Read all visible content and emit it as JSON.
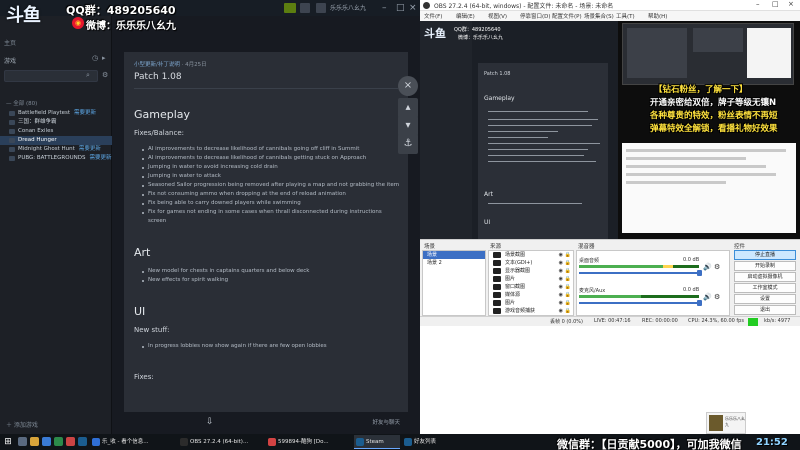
{
  "overlay": {
    "logo": "斗鱼",
    "qq_group": "QQ群：489205640",
    "weibo": "微博：乐乐乐八幺九",
    "taskbar_promo": "微信群：【日贡献5000】，可加我微信",
    "clock": "21:52"
  },
  "steam": {
    "user": "乐乐乐八幺九",
    "home_label": "主页",
    "filter_label": "游戏",
    "add_game_label": "添加游戏",
    "friends_label": "好友与聊天",
    "sidebar_games": [
      {
        "label": "— 全部 (80)",
        "header": true,
        "selected": false,
        "tag": ""
      },
      {
        "label": "Battlefield Playtest",
        "header": false,
        "selected": false,
        "tag": "需要更新"
      },
      {
        "label": "三国：群雄争霸",
        "header": false,
        "selected": false,
        "tag": ""
      },
      {
        "label": "Conan Exiles",
        "header": false,
        "selected": false,
        "tag": ""
      },
      {
        "label": "Dread Hunger",
        "header": false,
        "selected": true,
        "tag": ""
      },
      {
        "label": "Midnight Ghost Hunt",
        "header": false,
        "selected": false,
        "tag": "需要更新"
      },
      {
        "label": "PUBG: BATTLEGROUNDS",
        "header": false,
        "selected": false,
        "tag": "需要更新"
      }
    ],
    "news": {
      "meta_link": "小型更新/补丁说明",
      "meta_date": "4月25日",
      "title": "Patch 1.08",
      "sections": [
        {
          "heading": "Gameplay",
          "subheading": "Fixes/Balance:",
          "items": [
            "AI improvements to decrease likelihood of cannibals going off cliff in Summit",
            "AI improvements to decrease likelihood of cannibals getting stuck on Approach",
            "Jumping in water to avoid increasing cold drain",
            "Jumping in water to attack",
            "Seasoned Sailor progression being removed after playing a map and not grabbing the item",
            "Fix not consuming ammo when dropping at the end of reload animation",
            "Fix being able to carry downed players while swimming",
            "Fix for games not ending in some cases when thrall disconnected during instructions screen"
          ]
        },
        {
          "heading": "Art",
          "subheading": "",
          "items": [
            "New model for chests in captains quarters and below deck",
            "New effects for spirit walking"
          ]
        },
        {
          "heading": "UI",
          "subheading": "New stuff:",
          "items": [
            "In progress lobbies now show again if there are few open lobbies"
          ]
        },
        {
          "heading": "",
          "subheading": "Fixes:",
          "items": []
        }
      ]
    },
    "rail_icons": [
      "close-icon",
      "chevron-up-icon",
      "chevron-down-icon",
      "anchor-icon"
    ]
  },
  "obs": {
    "title": "OBS 27.2.4 (64-bit, windows) - 配置文件: 未命名 - 场景: 未命名",
    "menu": [
      "文件(F)",
      "编辑(E)",
      "视图(V)",
      "停靠窗口(D)",
      "配置文件(P)",
      "场景集合(S)",
      "工具(T)",
      "帮助(H)"
    ],
    "preview": {
      "news_title": "Patch 1.08",
      "gameplay": "Gameplay",
      "art": "Art",
      "ui": "UI",
      "qq": "QQ群：489205640",
      "weibo": "微博：乐乐乐八幺九",
      "danmu": [
        {
          "text": "【钻石粉丝，了解一下】",
          "color": "yellow"
        },
        {
          "text": "开通亲密给双倍，牌子等级无镶N",
          "color": "white"
        },
        {
          "text": "各种尊贵的特效，粉丝表情不再短",
          "color": "yellow"
        },
        {
          "text": "弹幕特效全解锁，看播礼物好效果",
          "color": "yellow"
        }
      ]
    },
    "docks": {
      "scenes_title": "场景",
      "sources_title": "来源",
      "mixer_title": "混音器",
      "controls_title": "控件"
    },
    "scenes": [
      "场景",
      "场景 2"
    ],
    "sources": [
      "场景截图",
      "文本(GDI+)",
      "显示器截图",
      "图片",
      "窗口截图",
      "媒体源",
      "图片",
      "游戏音频捕获"
    ],
    "mixer": [
      {
        "name": "桌面音频",
        "db": "0.0 dB",
        "level": 0.78
      },
      {
        "name": "麦克风/Aux",
        "db": "0.0 dB",
        "level": 0.52
      }
    ],
    "controls": [
      "停止直播",
      "开始录制",
      "启动虚拟摄像机",
      "工作室模式",
      "设置",
      "退出"
    ],
    "status": {
      "dropped": "丢帧 0 (0.0%)",
      "live": "LIVE: 00:47:16",
      "rec": "REC: 00:00:00",
      "cpu": "CPU: 24.3%, 60.00 fps",
      "kbps": "kb/s: 4977"
    }
  },
  "taskbar": {
    "tasks": [
      {
        "label": "乐_收 - 看个信息...",
        "color": "#2f6fd6",
        "active": false
      },
      {
        "label": "OBS 27.2.4 (64-bit)...",
        "color": "#2b2b2b",
        "active": false
      },
      {
        "label": "599894-酷狗 [Do...",
        "color": "#d34343",
        "active": false
      },
      {
        "label": "Steam",
        "color": "#1b5d8f",
        "active": true
      },
      {
        "label": "好友列表",
        "color": "#1b5d8f",
        "active": false
      }
    ]
  },
  "colors": {
    "steam_bg": "#171a21",
    "steam_pane": "#2a2e36",
    "obs_bg": "#f0f0f0",
    "obs_accent": "#3c6fc4",
    "danmu_yellow": "#ffe23d"
  }
}
